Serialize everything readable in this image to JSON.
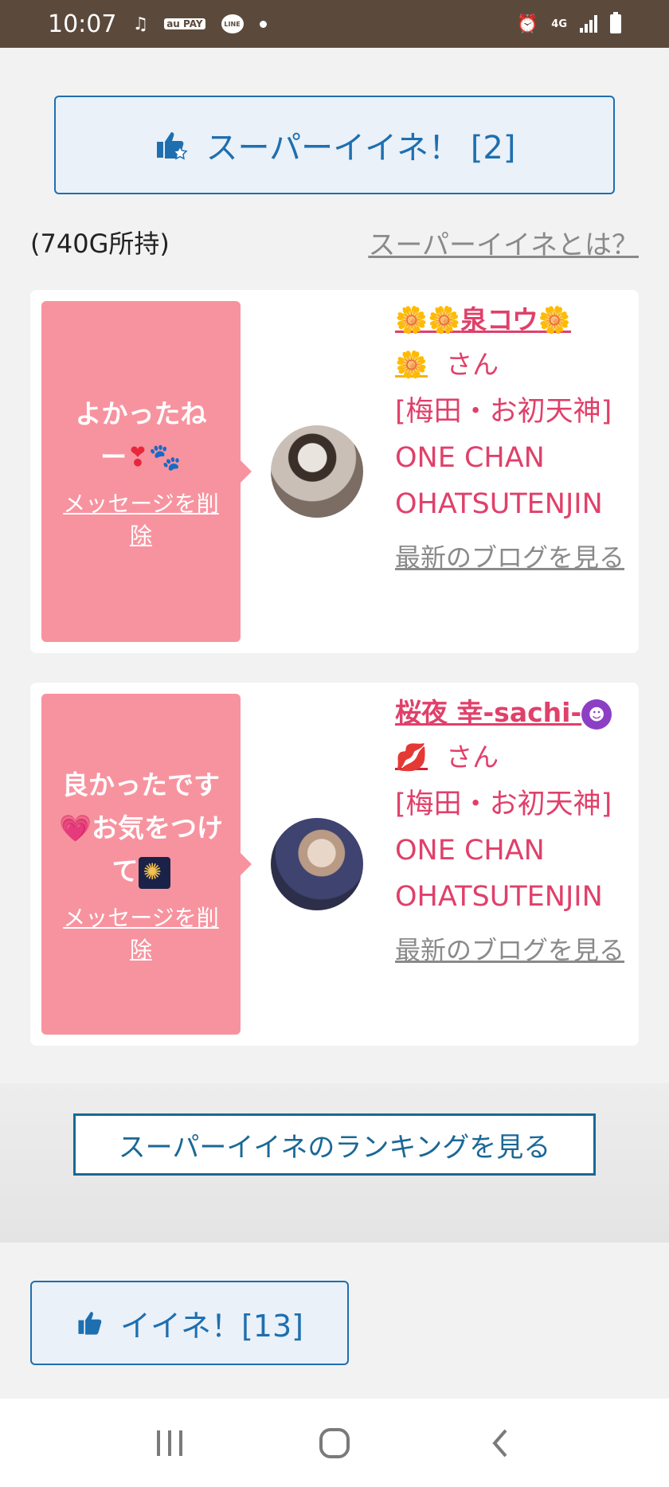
{
  "status_bar": {
    "time": "10:07",
    "au_pay_label": "au PAY",
    "line_label": "LINE",
    "network_label": "4G"
  },
  "super_like": {
    "button_label": "スーパーイイネ！ [2]",
    "points_text": "(740G所持)",
    "what_is_link": "スーパーイイネとは？"
  },
  "cards": [
    {
      "message_line1": "よかったね",
      "message_line2_prefix": "ー",
      "delete_label": "メッセージを削除",
      "name_prefix_emoji": "🌼🌼",
      "name": "泉コウ",
      "name_suffix_emoji": "🌼",
      "name_line2_emoji": "🌼",
      "san": "さん",
      "shop": "[梅田・お初天神] ONE CHAN OHATSUTENJIN",
      "blog_link": "最新のブログを見る"
    },
    {
      "message_line1": "良かったです",
      "message_line2": "お気をつけ",
      "message_line3": "て",
      "delete_label": "メッセージを削除",
      "name": "桜夜 幸-sachi-",
      "san": "さん",
      "shop": "[梅田・お初天神] ONE CHAN OHATSUTENJIN",
      "blog_link": "最新のブログを見る"
    }
  ],
  "ranking_button": "スーパーイイネのランキングを見る",
  "iine_button": "イイネ！[13]",
  "colors": {
    "accent_blue": "#1e6fb0",
    "pink_bubble": "#f7939f",
    "name_pink": "#e0406a",
    "status_bar": "#5b4a3c"
  }
}
